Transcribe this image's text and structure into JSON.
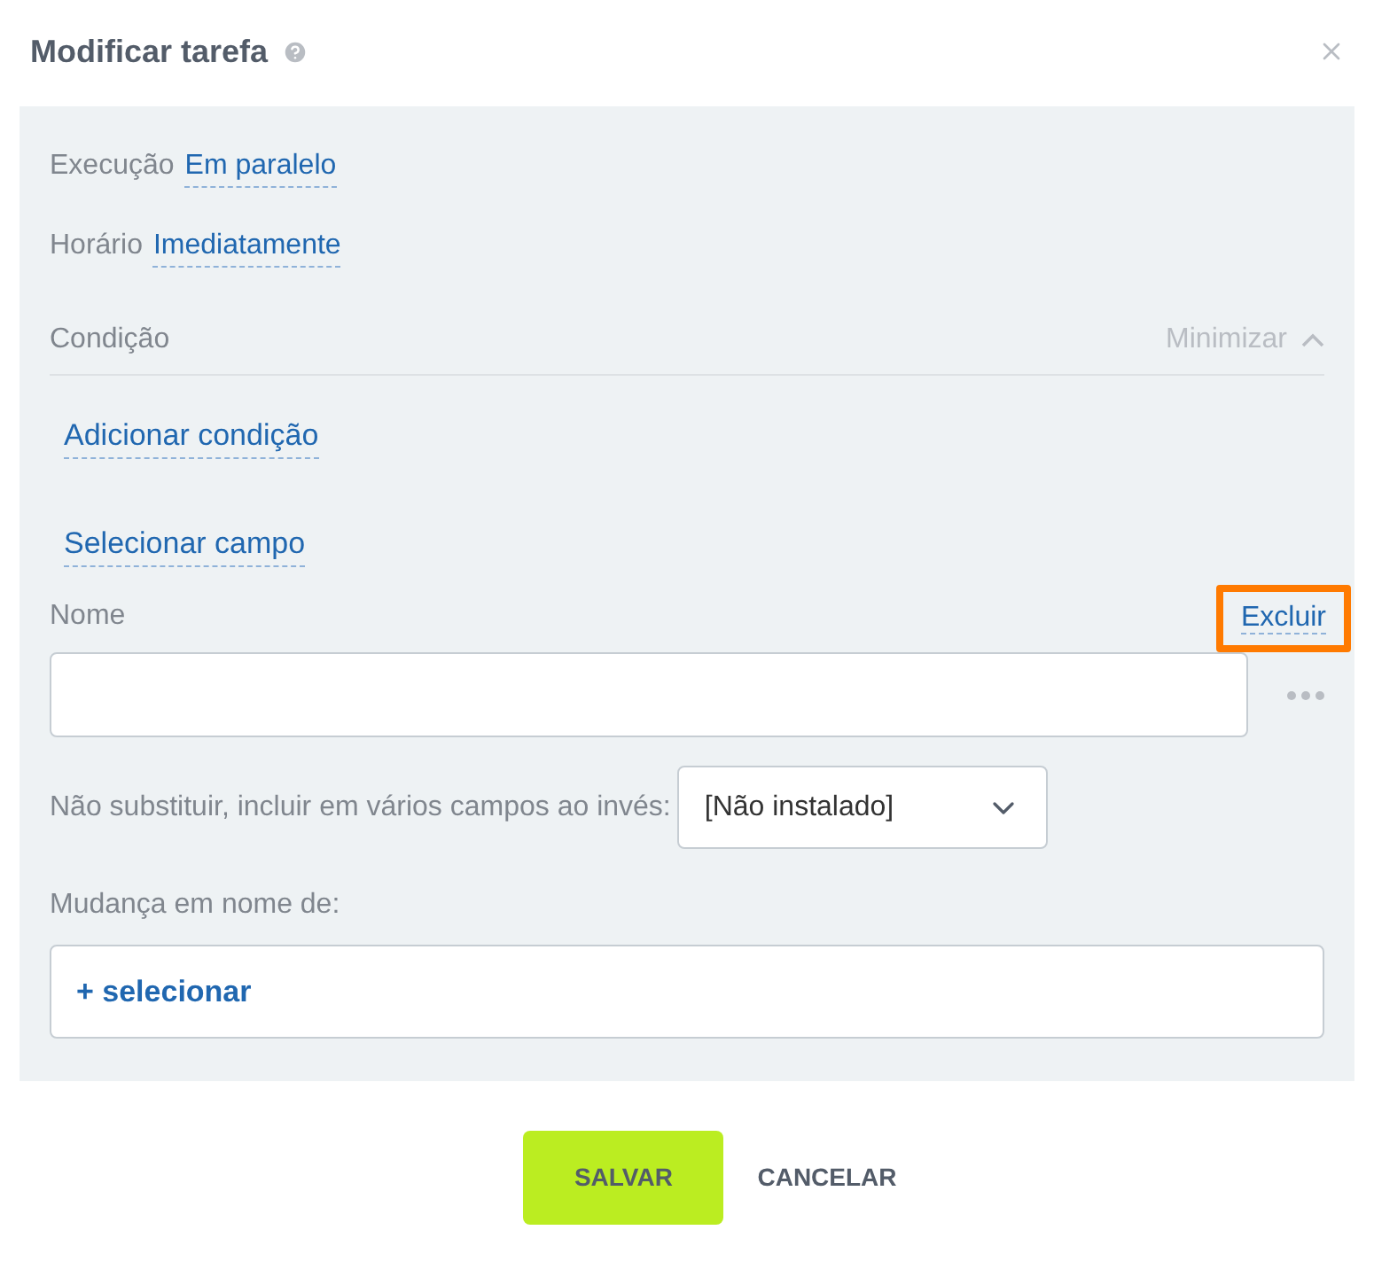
{
  "dialog": {
    "title": "Modificar tarefa"
  },
  "settings": [
    {
      "label": "Execução",
      "value": "Em paralelo"
    },
    {
      "label": "Horário",
      "value": "Imediatamente"
    }
  ],
  "condition": {
    "label": "Condição",
    "toggle": "Minimizar",
    "expanded": true,
    "links": [
      "Adicionar condição",
      "Selecionar campo"
    ]
  },
  "name_field": {
    "label": "Nome",
    "delete_link": "Excluir",
    "highlighted": true
  },
  "multiple_fields": {
    "label": "Não substituir, incluir em vários campos ao invés:",
    "value": "[Não instalado]"
  },
  "change_on_behalf": {
    "label": "Mudança em nome de:",
    "action": "+ selecionar"
  },
  "buttons": [
    {
      "kind": "primary",
      "label": "SALVAR"
    },
    {
      "kind": "secondary",
      "label": "CANCELAR"
    }
  ]
}
